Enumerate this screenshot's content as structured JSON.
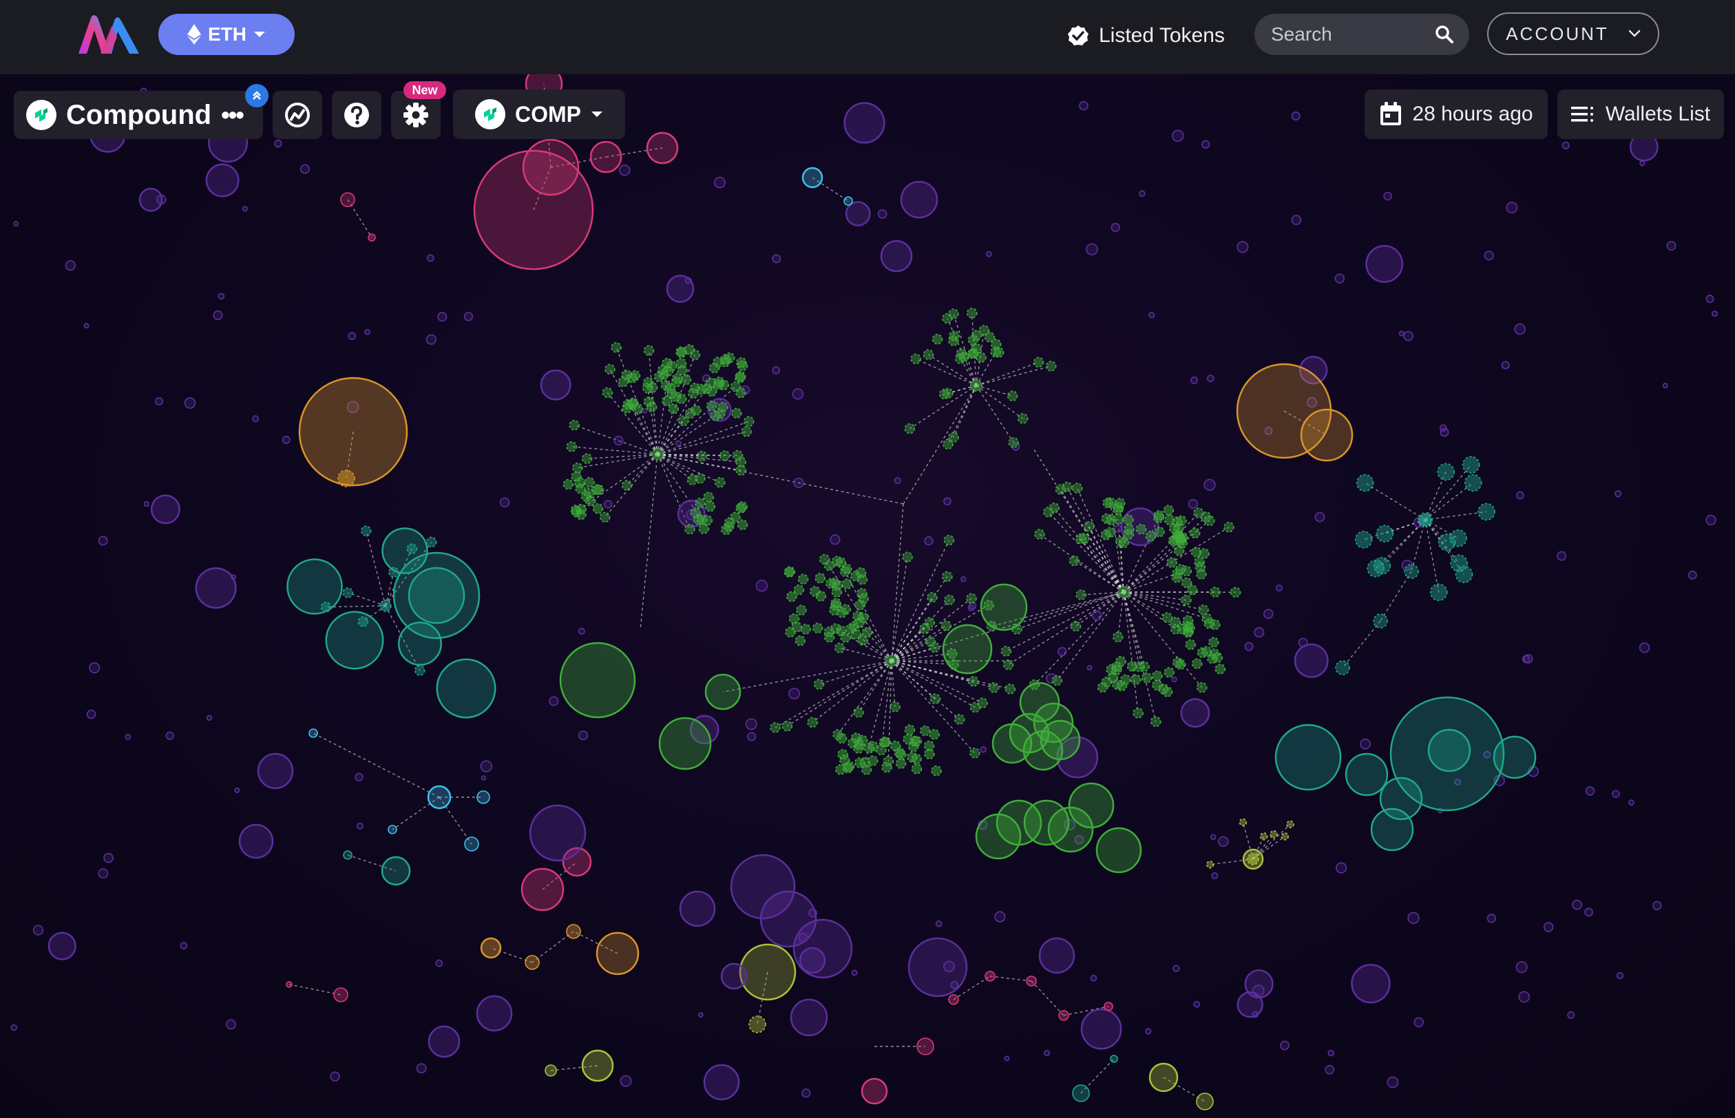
{
  "nav": {
    "network_label": "ETH",
    "listed_tokens_label": "Listed Tokens",
    "search_placeholder": "Search",
    "account_label": "ACCOUNT"
  },
  "toolbar": {
    "token_name": "Compound",
    "more_label": "•••",
    "settings_badge": "New",
    "selected_token": "COMP",
    "time_label": "28 hours ago",
    "wallets_list_label": "Wallets List"
  },
  "colors": {
    "nav_bg": "#1b1b22",
    "eth_button": "#6b7ff0",
    "new_badge": "#d8297e",
    "cluster_green": "#3fae3a",
    "teal": "#1fa88a",
    "pink": "#d83a78",
    "orange": "#d9952a",
    "purple": "#5b2f9c",
    "olive": "#a9c23a"
  }
}
